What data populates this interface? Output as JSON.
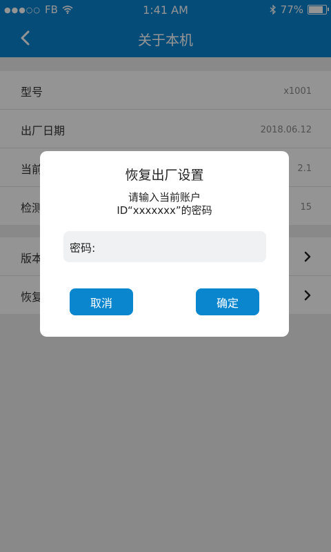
{
  "status_bar": {
    "signal_dots": "●●●○○",
    "carrier": "FB",
    "time": "1:41 AM",
    "battery_percent": "77%",
    "battery_level": 0.77,
    "icons": [
      "wifi-icon",
      "bluetooth-icon",
      "battery-icon"
    ]
  },
  "navbar": {
    "title": "关于本机",
    "back_icon": "chevron-left-icon"
  },
  "info_rows": [
    {
      "label": "型号",
      "value": "x1001"
    },
    {
      "label": "出厂日期",
      "value": "2018.06.12"
    },
    {
      "label": "当前",
      "value": "2.1"
    },
    {
      "label": "检测",
      "value": "15"
    }
  ],
  "action_rows": [
    {
      "label": "版本",
      "icon": "chevron-right-icon"
    },
    {
      "label": "恢复",
      "icon": "chevron-right-icon"
    }
  ],
  "dialog": {
    "title": "恢复出厂设置",
    "message_line1": "请输入当前账户",
    "message_line2": "ID“xxxxxxx”的密码",
    "password_label": "密码:",
    "password_value": "",
    "cancel_label": "取消",
    "confirm_label": "确定"
  },
  "colors": {
    "accent": "#0a86cf",
    "background": "#ececec",
    "overlay": "rgba(0,0,0,0.42)"
  }
}
